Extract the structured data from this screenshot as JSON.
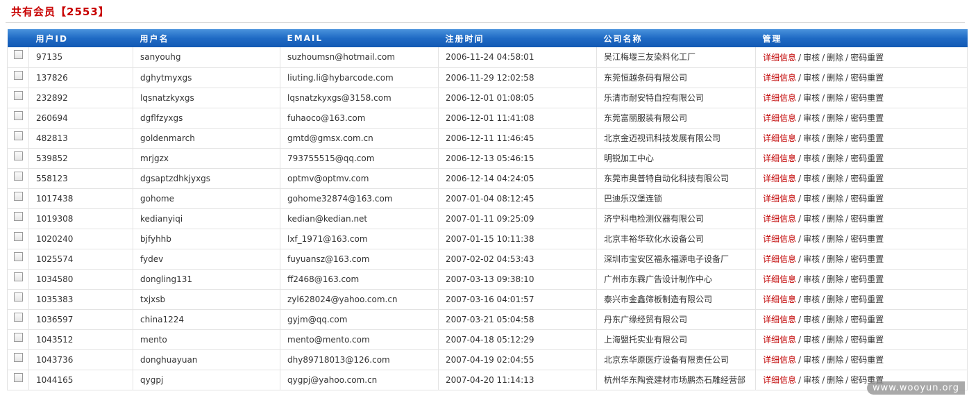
{
  "header": {
    "title_prefix": "共有会员",
    "count": "【2553】"
  },
  "table": {
    "columns": [
      "用户ID",
      "用户名",
      "EMAIL",
      "注册时间",
      "公司名称",
      "管理"
    ],
    "actions": {
      "detail": "详细信息",
      "audit": "审核",
      "delete": "删除",
      "reset": "密码重置",
      "sep": "/"
    },
    "rows": [
      {
        "id": "97135",
        "username": "sanyouhg",
        "email": "suzhoumsn@hotmail.com",
        "reg_time": "2006-11-24 04:58:01",
        "company": "吴江梅堰三友染料化工厂"
      },
      {
        "id": "137826",
        "username": "dghytmyxgs",
        "email": "liuting.li@hybarcode.com",
        "reg_time": "2006-11-29 12:02:58",
        "company": "东莞恒越条码有限公司"
      },
      {
        "id": "232892",
        "username": "lqsnatzkyxgs",
        "email": "lqsnatzkyxgs@3158.com",
        "reg_time": "2006-12-01 01:08:05",
        "company": "乐清市耐安特自控有限公司"
      },
      {
        "id": "260694",
        "username": "dgflfzyxgs",
        "email": "fuhaoco@163.com",
        "reg_time": "2006-12-01 11:41:08",
        "company": "东莞富丽服装有限公司"
      },
      {
        "id": "482813",
        "username": "goldenmarch",
        "email": "gmtd@gmsx.com.cn",
        "reg_time": "2006-12-11 11:46:45",
        "company": "北京金迈视讯科技发展有限公司"
      },
      {
        "id": "539852",
        "username": "mrjgzx",
        "email": "793755515@qq.com",
        "reg_time": "2006-12-13 05:46:15",
        "company": "明锐加工中心"
      },
      {
        "id": "558123",
        "username": "dgsaptzdhkjyxgs",
        "email": "optmv@optmv.com",
        "reg_time": "2006-12-14 04:24:05",
        "company": "东莞市奥普特自动化科技有限公司"
      },
      {
        "id": "1017438",
        "username": "gohome",
        "email": "gohome32874@163.com",
        "reg_time": "2007-01-04 08:12:45",
        "company": "巴迪乐汉堡连锁"
      },
      {
        "id": "1019308",
        "username": "kedianyiqi",
        "email": "kedian@kedian.net",
        "reg_time": "2007-01-11 09:25:09",
        "company": "济宁科电检测仪器有限公司"
      },
      {
        "id": "1020240",
        "username": "bjfyhhb",
        "email": "lxf_1971@163.com",
        "reg_time": "2007-01-15 10:11:38",
        "company": "北京丰裕华软化水设备公司"
      },
      {
        "id": "1025574",
        "username": "fydev",
        "email": "fuyuansz@163.com",
        "reg_time": "2007-02-02 04:53:43",
        "company": "深圳市宝安区福永福源电子设备厂"
      },
      {
        "id": "1034580",
        "username": "dongling131",
        "email": "ff2468@163.com",
        "reg_time": "2007-03-13 09:38:10",
        "company": "广州市东霖广告设计制作中心"
      },
      {
        "id": "1035383",
        "username": "txjxsb",
        "email": "zyl628024@yahoo.com.cn",
        "reg_time": "2007-03-16 04:01:57",
        "company": "泰兴市金鑫筛板制造有限公司"
      },
      {
        "id": "1036597",
        "username": "china1224",
        "email": "gyjm@qq.com",
        "reg_time": "2007-03-21 05:04:58",
        "company": "丹东广缘经贸有限公司"
      },
      {
        "id": "1043512",
        "username": "mento",
        "email": "mento@mento.com",
        "reg_time": "2007-04-18 05:12:29",
        "company": "上海盟托实业有限公司"
      },
      {
        "id": "1043736",
        "username": "donghuayuan",
        "email": "dhy89718013@126.com",
        "reg_time": "2007-04-19 02:04:55",
        "company": "北京东华原医疗设备有限责任公司"
      },
      {
        "id": "1044165",
        "username": "qygpj",
        "email": "qygpj@yahoo.com.cn",
        "reg_time": "2007-04-20 11:14:13",
        "company": "杭州华东陶瓷建材市场鹏杰石雕经营部"
      }
    ]
  },
  "watermark": "www.wooyun.org"
}
